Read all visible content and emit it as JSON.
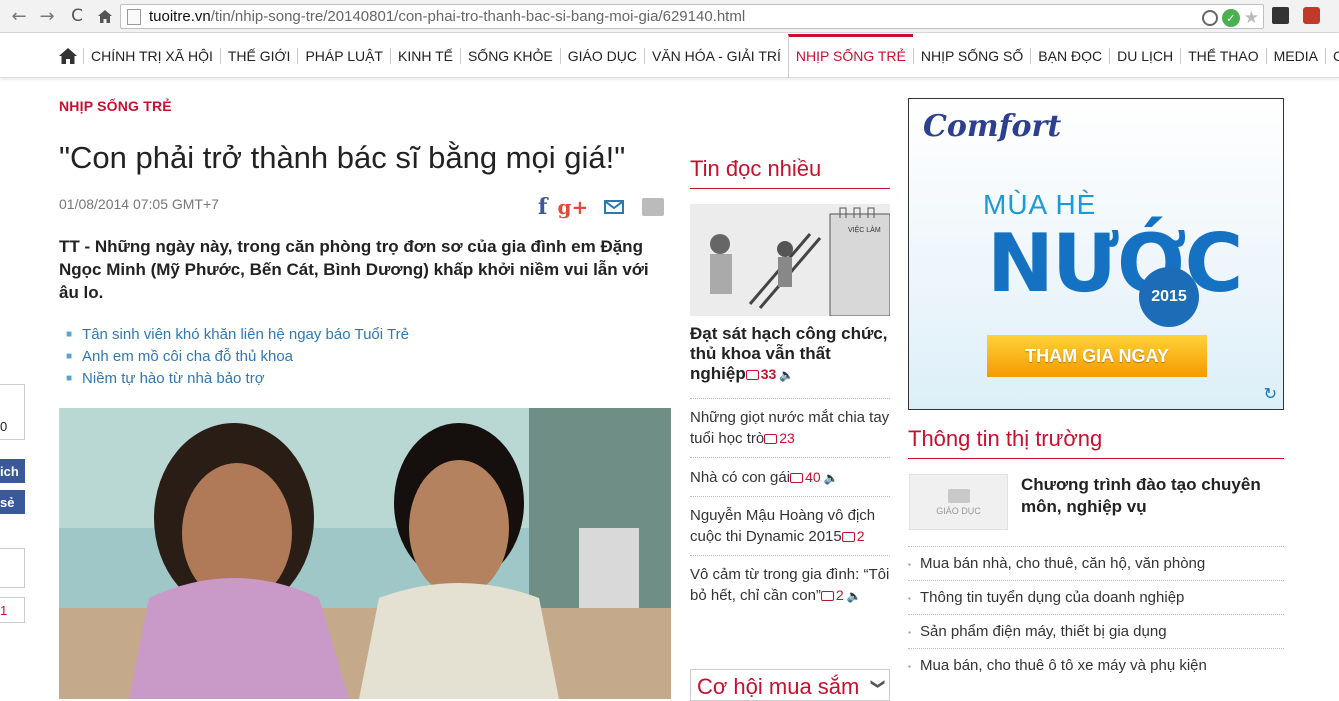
{
  "browser": {
    "url_host": "tuoitre.vn",
    "url_path": "/tin/nhip-song-tre/20140801/con-phai-tro-thanh-bac-si-bang-moi-gia/629140.html",
    "back_icon": "←",
    "forward_icon": "→",
    "reload_icon": "C",
    "star_icon": "★"
  },
  "nav": {
    "items": [
      "CHÍNH TRỊ XÃ HỘI",
      "THẾ GIỚI",
      "PHÁP LUẬT",
      "KINH TẾ",
      "SỐNG KHỎE",
      "GIÁO DỤC",
      "VĂN HÓA - GIẢI TRÍ",
      "NHỊP SỐNG TRẺ",
      "NHỊP SỐNG SỐ",
      "BẠN ĐỌC",
      "DU LỊCH",
      "THỂ THAO",
      "MEDIA",
      "CẦN BIẾT"
    ],
    "active_index": 7
  },
  "left_sliver": {
    "count": "0",
    "btn1": "ich",
    "btn2": "sẻ",
    "count2": "1"
  },
  "article": {
    "category": "NHỊP SỐNG TRẺ",
    "title": "\"Con phải trở thành bác sĩ bằng mọi giá!\"",
    "date": "01/08/2014 07:05 GMT+7",
    "lead": "TT - Những ngày này, trong căn phòng trọ đơn sơ của gia đình em Đặng Ngọc Minh (Mỹ Phước, Bến Cát, Bình Dương) khấp khởi niềm vui lẫn với âu lo.",
    "related": [
      "Tân sinh viên khó khăn liên hệ ngay báo Tuổi Trẻ",
      "Anh em mồ côi cha đỗ thủ khoa",
      "Niềm tự hào từ nhà bảo trợ"
    ],
    "share": {
      "fb": "f",
      "gplus": "g+"
    }
  },
  "most_read": {
    "title": "Tin đọc nhiều",
    "thumb_sign": "VIỆC LÀM",
    "featured": {
      "text": "Đạt sát hạch công chức, thủ khoa vẫn thất nghiệp",
      "comments": "33"
    },
    "items": [
      {
        "text": "Những giọt nước mắt chia tay tuổi học trò",
        "comments": "23",
        "audio": false
      },
      {
        "text": "Nhà có con gái",
        "comments": "40",
        "audio": true
      },
      {
        "text": "Nguyễn Mậu Hoàng vô địch cuộc thi Dynamic 2015",
        "comments": "2",
        "audio": false
      },
      {
        "text": "Vô cảm từ trong gia đình: “Tôi bỏ hết, chỉ cần con”",
        "comments": "2",
        "audio": true
      }
    ]
  },
  "shopping": {
    "title": "Cơ hội mua sắm",
    "chevron": "❯"
  },
  "ad": {
    "brand": "Comfort",
    "line1": "MÙA HÈ",
    "line2": "NƯỚC",
    "year": "2015",
    "cta": "THAM GIA NGAY",
    "replay_icon": "↻"
  },
  "market": {
    "title": "Thông tin thị trường",
    "thumb_label": "GIÁO DỤC",
    "featured": "Chương trình đào tạo chuyên môn, nghiệp vụ",
    "items": [
      "Mua bán nhà, cho thuê, căn hộ, văn phòng",
      "Thông tin tuyển dụng của doanh nghiệp",
      "Sản phẩm điện máy, thiết bị gia dụng",
      "Mua bán, cho thuê ô tô xe máy và phụ kiện"
    ]
  }
}
